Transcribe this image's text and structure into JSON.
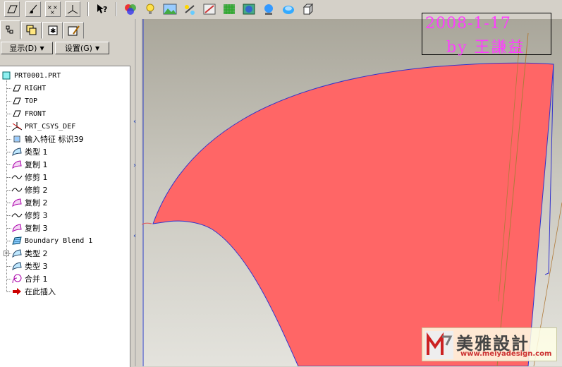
{
  "toolbar": {
    "icons": [
      "datum-plane-display-icon",
      "datum-axis-display-icon",
      "point-display-icon",
      "csys-display-icon",
      "context-help-icon",
      "appearance-icon",
      "light-icon",
      "scene-icon",
      "render-icon",
      "model-tree-icon",
      "texture-icon",
      "environment-icon",
      "perspective-icon",
      "color-palette-icon",
      "cube-icon"
    ]
  },
  "panel": {
    "tabs": [
      "model-tree-tab",
      "layers-tab",
      "favorites-tab",
      "browser-tab"
    ],
    "show_menu": "显示(D)",
    "settings_menu": "设置(G)"
  },
  "tree": {
    "items": [
      {
        "label": "PRT0001.PRT",
        "icon": "part-icon"
      },
      {
        "label": "RIGHT",
        "icon": "datum-plane-icon"
      },
      {
        "label": "TOP",
        "icon": "datum-plane-icon"
      },
      {
        "label": "FRONT",
        "icon": "datum-plane-icon"
      },
      {
        "label": "PRT_CSYS_DEF",
        "icon": "csys-icon"
      },
      {
        "label": "输入特征 标识39",
        "icon": "import-feature-icon"
      },
      {
        "label": "类型 1",
        "icon": "surface-icon"
      },
      {
        "label": "复制 1",
        "icon": "copy-icon"
      },
      {
        "label": "修剪 1",
        "icon": "trim-icon"
      },
      {
        "label": "修剪 2",
        "icon": "trim-icon"
      },
      {
        "label": "复制 2",
        "icon": "copy-icon"
      },
      {
        "label": "修剪 3",
        "icon": "trim-icon"
      },
      {
        "label": "复制 3",
        "icon": "copy-icon"
      },
      {
        "label": "Boundary Blend 1",
        "icon": "boundary-blend-icon"
      },
      {
        "label": "类型 2",
        "icon": "surface-icon"
      },
      {
        "label": "类型 3",
        "icon": "surface-icon"
      },
      {
        "label": "合并 1",
        "icon": "merge-icon"
      },
      {
        "label": "在此插入",
        "icon": "insert-here-icon"
      }
    ]
  },
  "viewport": {
    "surface_color": "#ff6666",
    "edge_color": "#3333cc",
    "stamp_date": "2008-1-17",
    "stamp_by": "by 王謙益"
  },
  "logo": {
    "name": "美雅設計",
    "url": "www.meiyadesign.com"
  }
}
